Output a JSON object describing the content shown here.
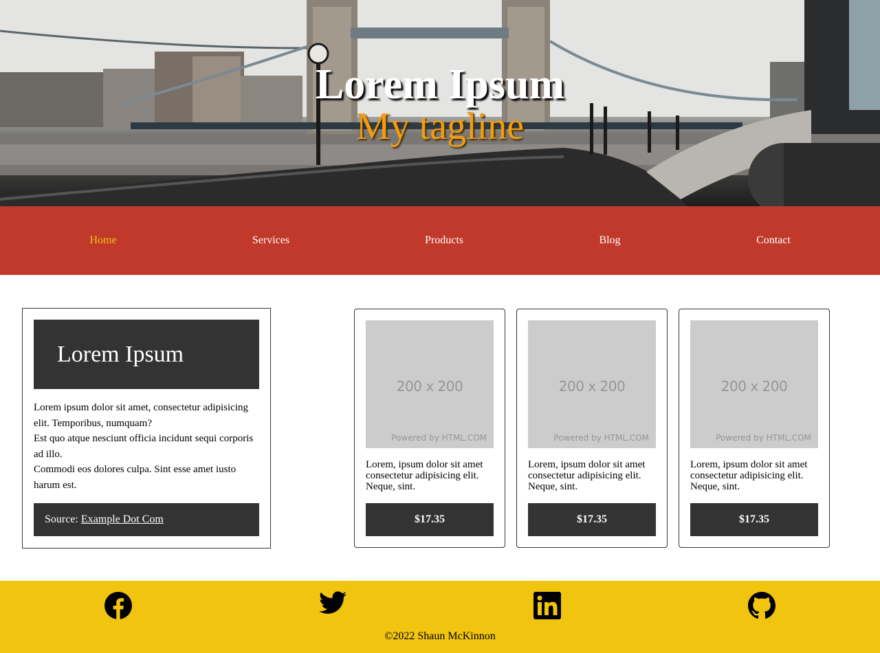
{
  "hero": {
    "title": "Lorem Ipsum",
    "tagline": "My tagline"
  },
  "nav": {
    "items": [
      {
        "label": "Home",
        "active": true
      },
      {
        "label": "Services"
      },
      {
        "label": "Products"
      },
      {
        "label": "Blog"
      },
      {
        "label": "Contact"
      }
    ]
  },
  "article": {
    "title": "Lorem Ipsum",
    "lines": [
      "Lorem ipsum dolor sit amet, consectetur adipisicing elit. Temporibus, numquam?",
      "Est quo atque nesciunt officia incidunt sequi corporis ad illo.",
      "Commodi eos dolores culpa. Sint esse amet iusto harum est."
    ],
    "source_label": "Source:",
    "source_link": "Example Dot Com"
  },
  "products": [
    {
      "placeholder": "200 x 200",
      "powered": "Powered by HTML.COM",
      "description": "Lorem, ipsum dolor sit amet consectetur adipisicing elit. Neque, sint.",
      "price": "$17.35"
    },
    {
      "placeholder": "200 x 200",
      "powered": "Powered by HTML.COM",
      "description": "Lorem, ipsum dolor sit amet consectetur adipisicing elit. Neque, sint.",
      "price": "$17.35"
    },
    {
      "placeholder": "200 x 200",
      "powered": "Powered by HTML.COM",
      "description": "Lorem, ipsum dolor sit amet consectetur adipisicing elit. Neque, sint.",
      "price": "$17.35"
    }
  ],
  "footer": {
    "social_icons": [
      "facebook-icon",
      "twitter-icon",
      "linkedin-icon",
      "github-icon"
    ],
    "copyright": "©2022 Shaun McKinnon"
  },
  "colors": {
    "nav_bg": "#c0392b",
    "nav_active": "#f1c40f",
    "tagline": "#f39c12",
    "footer_bg": "#f1c40f",
    "dark_block": "#333333"
  }
}
